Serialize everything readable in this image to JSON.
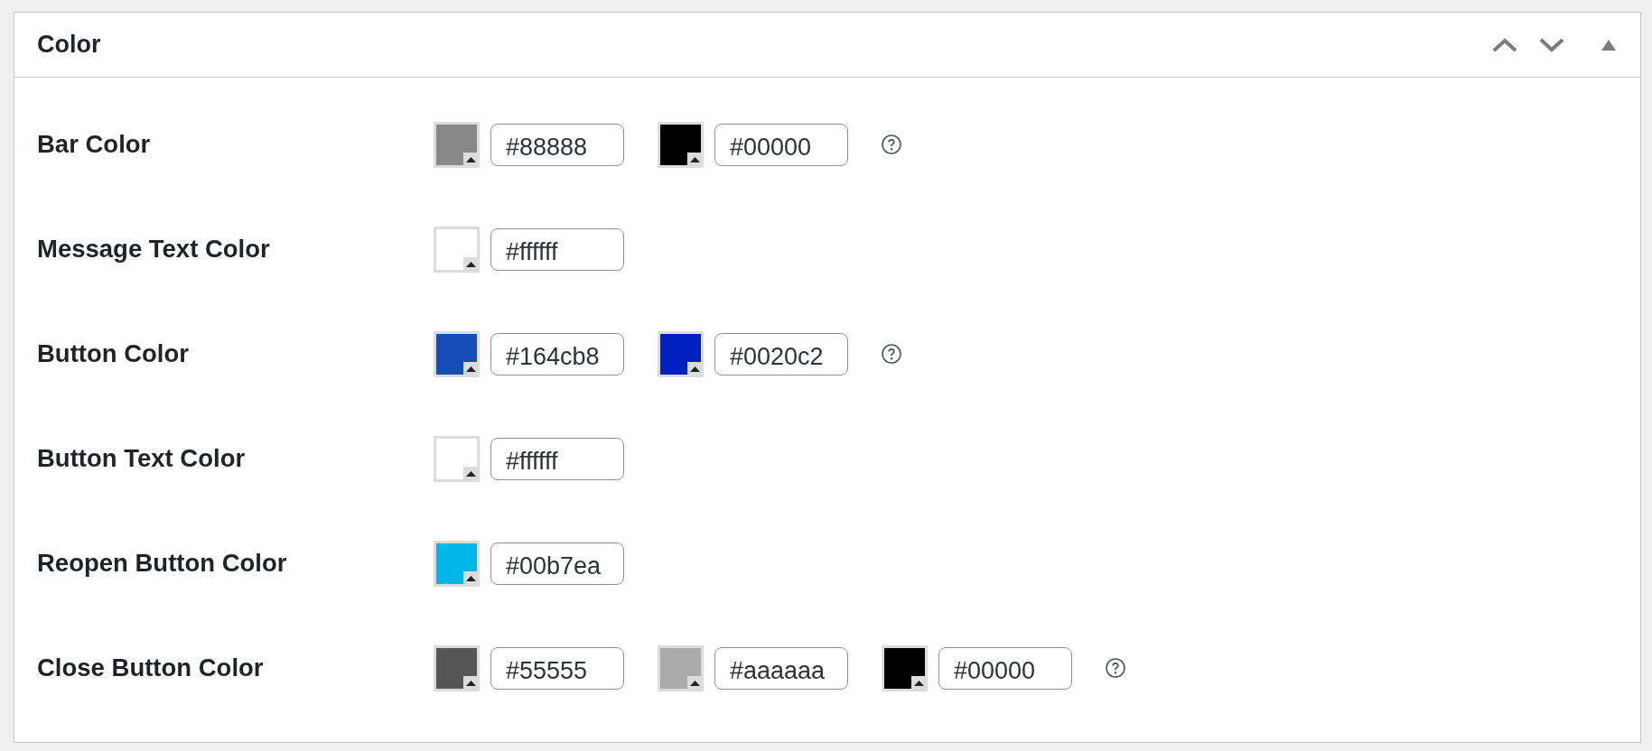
{
  "panel": {
    "title": "Color",
    "rows": [
      {
        "label": "Bar Color",
        "colors": [
          {
            "color": "#888888",
            "value": "#88888"
          },
          {
            "color": "#000000",
            "value": "#00000"
          }
        ],
        "help": true
      },
      {
        "label": "Message Text Color",
        "colors": [
          {
            "color": "#ffffff",
            "value": "#ffffff"
          }
        ],
        "help": false
      },
      {
        "label": "Button Color",
        "colors": [
          {
            "color": "#164cb8",
            "value": "#164cb8"
          },
          {
            "color": "#0020c2",
            "value": "#0020c2"
          }
        ],
        "help": true
      },
      {
        "label": "Button Text Color",
        "colors": [
          {
            "color": "#ffffff",
            "value": "#ffffff"
          }
        ],
        "help": false
      },
      {
        "label": "Reopen Button Color",
        "colors": [
          {
            "color": "#00b7ea",
            "value": "#00b7ea"
          }
        ],
        "help": false
      },
      {
        "label": "Close Button Color",
        "colors": [
          {
            "color": "#555555",
            "value": "#55555"
          },
          {
            "color": "#aaaaaa",
            "value": "#aaaaaa"
          },
          {
            "color": "#000000",
            "value": "#00000"
          }
        ],
        "help": true
      }
    ]
  }
}
